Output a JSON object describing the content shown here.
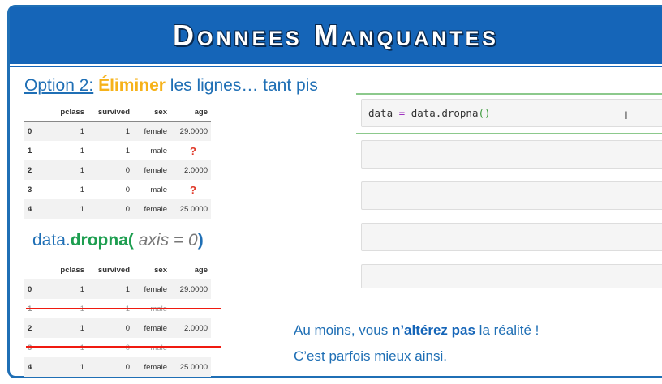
{
  "header": {
    "title": "Donnees Manquantes"
  },
  "title": {
    "option": "Option 2:",
    "elim": "Éliminer",
    "rest": " les lignes… tant pis"
  },
  "table_columns": [
    "",
    "pclass",
    "survived",
    "sex",
    "age"
  ],
  "table_before": [
    [
      "0",
      "1",
      "1",
      "female",
      "29.0000"
    ],
    [
      "1",
      "1",
      "1",
      "male",
      "?"
    ],
    [
      "2",
      "1",
      "0",
      "female",
      "2.0000"
    ],
    [
      "3",
      "1",
      "0",
      "male",
      "?"
    ],
    [
      "4",
      "1",
      "0",
      "female",
      "25.0000"
    ]
  ],
  "dropna": {
    "obj": "data.",
    "fn": "dropna",
    "open": "(",
    "arg": " axis = 0",
    "close": ")"
  },
  "table_after": [
    [
      "0",
      "1",
      "1",
      "female",
      "29.0000"
    ],
    [
      "1",
      "1",
      "1",
      "male",
      ""
    ],
    [
      "2",
      "1",
      "0",
      "female",
      "2.0000"
    ],
    [
      "3",
      "1",
      "0",
      "male",
      ""
    ],
    [
      "4",
      "1",
      "0",
      "female",
      "25.0000"
    ]
  ],
  "code": {
    "a": "data ",
    "eq": "=",
    "b": " data.dropna",
    "par": "()"
  },
  "cursor": "I",
  "note": {
    "l1a": "Au moins, vous ",
    "l1b": "n’altérez pas",
    "l1c": " la réalité !",
    "l2": "C’est parfois mieux ainsi."
  }
}
